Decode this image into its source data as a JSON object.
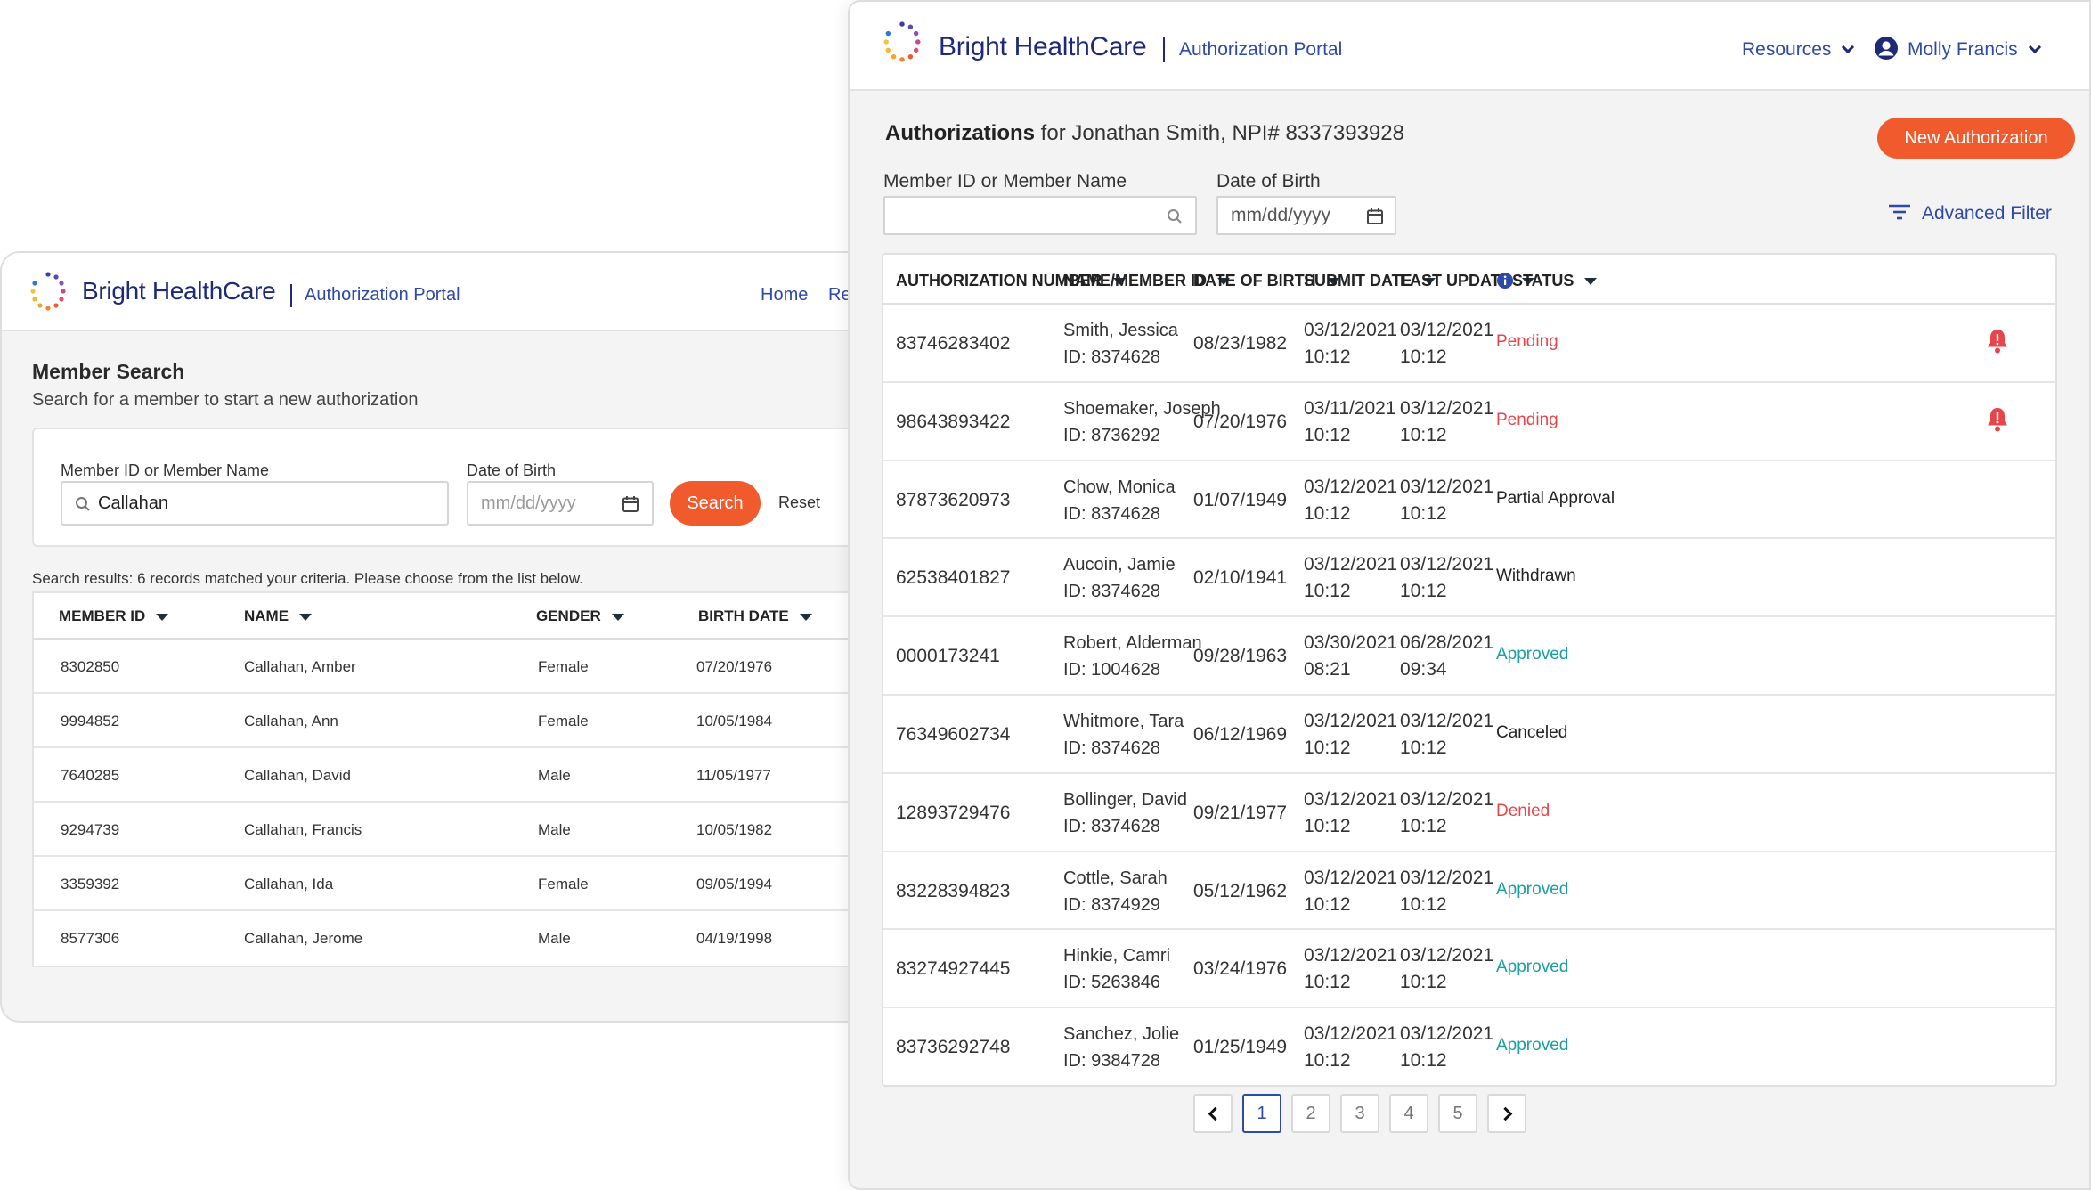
{
  "colors": {
    "accent": "#f05a2c",
    "brand": "#1e2a78",
    "link": "#2f4aa6",
    "pending": "#e8454a",
    "denied": "#e8454a",
    "approved": "#1a9fa3"
  },
  "left": {
    "brand": "Bright HealthCare",
    "portal": "Authorization Portal",
    "nav": [
      "Home",
      "Re"
    ],
    "title": "Member Search",
    "subtitle": "Search for a member to start a new authorization",
    "search": {
      "member_label": "Member ID or Member Name",
      "member_value": "Callahan",
      "dob_label": "Date of Birth",
      "dob_placeholder": "mm/dd/yyyy",
      "search_btn": "Search",
      "reset": "Reset"
    },
    "results_text": "Search results: 6 records matched your criteria. Please choose from the list below.",
    "columns": [
      "MEMBER ID",
      "NAME",
      "GENDER",
      "BIRTH DATE"
    ],
    "rows": [
      {
        "id": "8302850",
        "name": "Callahan, Amber",
        "gender": "Female",
        "dob": "07/20/1976"
      },
      {
        "id": "9994852",
        "name": "Callahan, Ann",
        "gender": "Female",
        "dob": "10/05/1984"
      },
      {
        "id": "7640285",
        "name": "Callahan, David",
        "gender": "Male",
        "dob": "11/05/1977"
      },
      {
        "id": "9294739",
        "name": "Callahan, Francis",
        "gender": "Male",
        "dob": "10/05/1982"
      },
      {
        "id": "3359392",
        "name": "Callahan, Ida",
        "gender": "Female",
        "dob": "09/05/1994"
      },
      {
        "id": "8577306",
        "name": "Callahan, Jerome",
        "gender": "Male",
        "dob": "04/19/1998"
      }
    ]
  },
  "right": {
    "brand": "Bright HealthCare",
    "portal": "Authorization Portal",
    "resources": "Resources",
    "user": "Molly Francis",
    "title_bold": "Authorizations",
    "title_rest": "for Jonathan Smith, NPI# 8337393928",
    "new_auth": "New Authorization",
    "member_label": "Member ID or Member Name",
    "dob_label": "Date of Birth",
    "dob_placeholder": "mm/dd/yyyy",
    "advanced_filter": "Advanced Filter",
    "columns": [
      "AUTHORIZATION NUMBER",
      "NAME/MEMBER ID",
      "DATE OF BIRTH",
      "SUBMIT DATE",
      "LAST UPDATE",
      "STATUS"
    ],
    "rows": [
      {
        "auth": "83746283402",
        "name": "Smith, Jessica",
        "mid": "ID: 8374628",
        "dob": "08/23/1982",
        "sub_d": "03/12/2021",
        "sub_t": "10:12",
        "upd_d": "03/12/2021",
        "upd_t": "10:12",
        "status": "Pending",
        "tone": "pending",
        "alert": true
      },
      {
        "auth": "98643893422",
        "name": "Shoemaker, Joseph",
        "mid": "ID: 8736292",
        "dob": "07/20/1976",
        "sub_d": "03/11/2021",
        "sub_t": "10:12",
        "upd_d": "03/12/2021",
        "upd_t": "10:12",
        "status": "Pending",
        "tone": "pending",
        "alert": true
      },
      {
        "auth": "87873620973",
        "name": "Chow, Monica",
        "mid": "ID: 8374628",
        "dob": "01/07/1949",
        "sub_d": "03/12/2021",
        "sub_t": "10:12",
        "upd_d": "03/12/2021",
        "upd_t": "10:12",
        "status": "Partial Approval",
        "tone": "neutral",
        "alert": false
      },
      {
        "auth": "62538401827",
        "name": "Aucoin, Jamie",
        "mid": "ID: 8374628",
        "dob": "02/10/1941",
        "sub_d": "03/12/2021",
        "sub_t": "10:12",
        "upd_d": "03/12/2021",
        "upd_t": "10:12",
        "status": "Withdrawn",
        "tone": "neutral",
        "alert": false
      },
      {
        "auth": "0000173241",
        "name": "Robert, Alderman",
        "mid": "ID: 1004628",
        "dob": "09/28/1963",
        "sub_d": "03/30/2021",
        "sub_t": "08:21",
        "upd_d": "06/28/2021",
        "upd_t": "09:34",
        "status": "Approved",
        "tone": "approved",
        "alert": false
      },
      {
        "auth": "76349602734",
        "name": "Whitmore, Tara",
        "mid": "ID: 8374628",
        "dob": "06/12/1969",
        "sub_d": "03/12/2021",
        "sub_t": "10:12",
        "upd_d": "03/12/2021",
        "upd_t": "10:12",
        "status": "Canceled",
        "tone": "neutral",
        "alert": false
      },
      {
        "auth": "12893729476",
        "name": "Bollinger, David",
        "mid": "ID: 8374628",
        "dob": "09/21/1977",
        "sub_d": "03/12/2021",
        "sub_t": "10:12",
        "upd_d": "03/12/2021",
        "upd_t": "10:12",
        "status": "Denied",
        "tone": "denied",
        "alert": false
      },
      {
        "auth": "83228394823",
        "name": "Cottle, Sarah",
        "mid": "ID: 8374929",
        "dob": "05/12/1962",
        "sub_d": "03/12/2021",
        "sub_t": "10:12",
        "upd_d": "03/12/2021",
        "upd_t": "10:12",
        "status": "Approved",
        "tone": "approved",
        "alert": false
      },
      {
        "auth": "83274927445",
        "name": "Hinkie, Camri",
        "mid": "ID: 5263846",
        "dob": "03/24/1976",
        "sub_d": "03/12/2021",
        "sub_t": "10:12",
        "upd_d": "03/12/2021",
        "upd_t": "10:12",
        "status": "Approved",
        "tone": "approved",
        "alert": false
      },
      {
        "auth": "83736292748",
        "name": "Sanchez, Jolie",
        "mid": "ID: 9384728",
        "dob": "01/25/1949",
        "sub_d": "03/12/2021",
        "sub_t": "10:12",
        "upd_d": "03/12/2021",
        "upd_t": "10:12",
        "status": "Approved",
        "tone": "approved",
        "alert": false
      }
    ],
    "pages": [
      "1",
      "2",
      "3",
      "4",
      "5"
    ],
    "current_page": "1"
  }
}
